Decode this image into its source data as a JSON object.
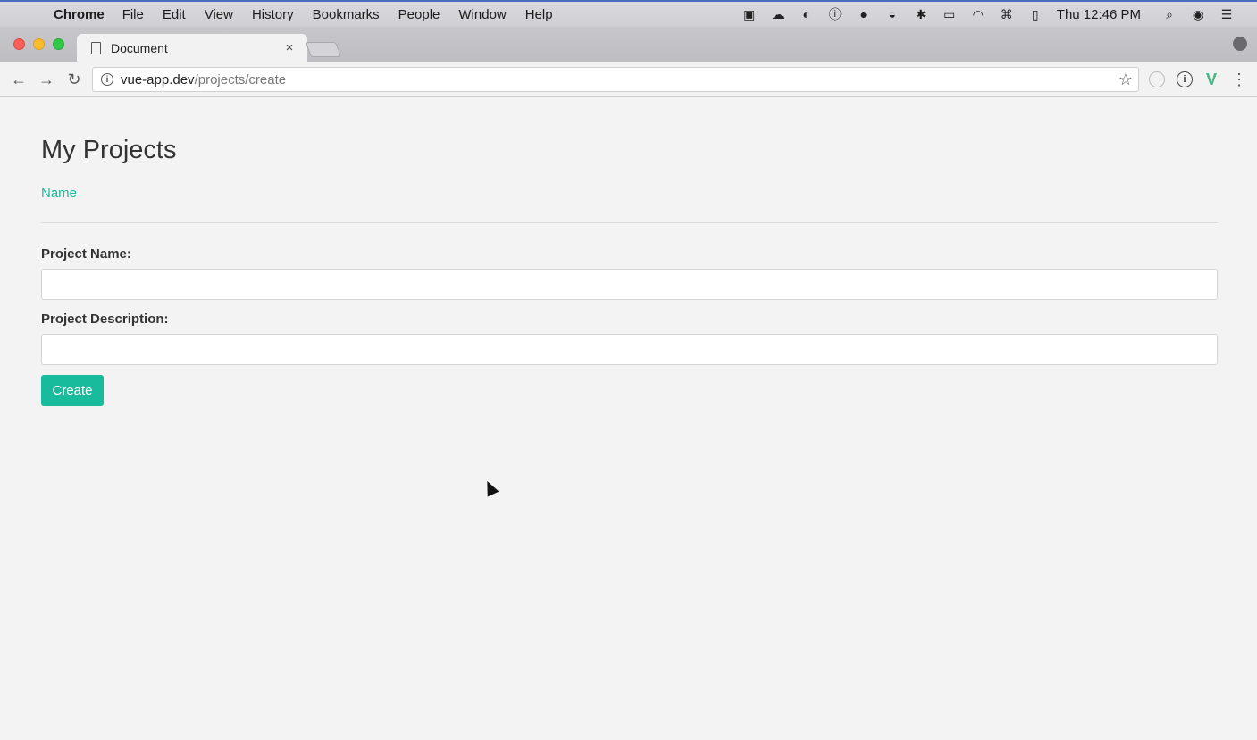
{
  "menubar": {
    "app_name": "Chrome",
    "items": [
      "File",
      "Edit",
      "View",
      "History",
      "Bookmarks",
      "People",
      "Window",
      "Help"
    ],
    "clock": "Thu 12:46 PM"
  },
  "browser": {
    "tab_title": "Document",
    "tab_close": "×",
    "url_host": "vue-app.dev",
    "url_path": "/projects/create"
  },
  "page": {
    "title": "My Projects",
    "list_link": "Name",
    "form": {
      "name_label": "Project Name:",
      "name_value": "",
      "description_label": "Project Description:",
      "description_value": "",
      "submit_label": "Create"
    }
  },
  "colors": {
    "accent": "#18bc9c",
    "link": "#1abc9c"
  }
}
